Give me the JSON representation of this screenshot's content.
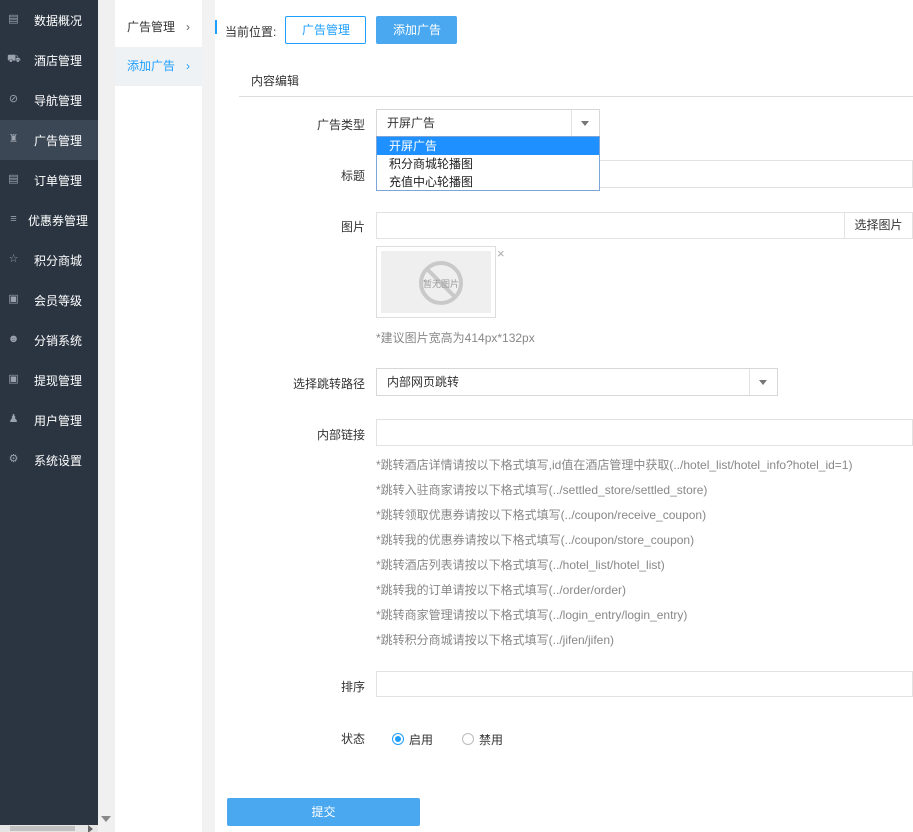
{
  "sidebar": {
    "items": [
      {
        "label": "数据概况",
        "icon": "chart-icon"
      },
      {
        "label": "酒店管理",
        "icon": "cart-icon"
      },
      {
        "label": "导航管理",
        "icon": "compass-icon"
      },
      {
        "label": "广告管理",
        "icon": "gift-icon",
        "active": true
      },
      {
        "label": "订单管理",
        "icon": "list-icon"
      },
      {
        "label": "优惠券管理",
        "icon": "menu-icon"
      },
      {
        "label": "积分商城",
        "icon": "star-icon"
      },
      {
        "label": "会员等级",
        "icon": "money-icon"
      },
      {
        "label": "分销系统",
        "icon": "users-icon"
      },
      {
        "label": "提现管理",
        "icon": "money-icon"
      },
      {
        "label": "用户管理",
        "icon": "user-icon"
      },
      {
        "label": "系统设置",
        "icon": "gear-icon"
      }
    ]
  },
  "subnav": {
    "items": [
      {
        "label": "广告管理",
        "chevron": "›"
      },
      {
        "label": "添加广告",
        "chevron": "›",
        "active": true
      }
    ]
  },
  "breadcrumb": {
    "label": "当前位置:",
    "items": [
      "广告管理",
      "添加广告"
    ]
  },
  "form": {
    "section_title": "内容编辑",
    "ad_type": {
      "label": "广告类型",
      "value": "开屏广告",
      "options": [
        "开屏广告",
        "积分商城轮播图",
        "充值中心轮播图"
      ]
    },
    "title": {
      "label": "标题",
      "value": ""
    },
    "image": {
      "label": "图片",
      "value": "",
      "pick_button": "选择图片",
      "placeholder_text": "暂无图片",
      "close_glyph": "×",
      "hint": "*建议图片宽高为414px*132px"
    },
    "jump_path": {
      "label": "选择跳转路径",
      "value": "内部网页跳转"
    },
    "inner_link": {
      "label": "内部链接",
      "value": "",
      "hints": [
        "*跳转酒店详情请按以下格式填写,id值在酒店管理中获取(../hotel_list/hotel_info?hotel_id=1)",
        "*跳转入驻商家请按以下格式填写(../settled_store/settled_store)",
        "*跳转领取优惠券请按以下格式填写(../coupon/receive_coupon)",
        "*跳转我的优惠券请按以下格式填写(../coupon/store_coupon)",
        "*跳转酒店列表请按以下格式填写(../hotel_list/hotel_list)",
        "*跳转我的订单请按以下格式填写(../order/order)",
        "*跳转商家管理请按以下格式填写(../login_entry/login_entry)",
        "*跳转积分商城请按以下格式填写(../jifen/jifen)"
      ]
    },
    "sort": {
      "label": "排序",
      "value": ""
    },
    "status": {
      "label": "状态",
      "options": [
        {
          "label": "启用",
          "checked": true
        },
        {
          "label": "禁用",
          "checked": false
        }
      ]
    },
    "submit_label": "提交"
  },
  "colors": {
    "sidebar_bg": "#2b3542",
    "accent": "#1e9fff",
    "button_fill": "#4aa8f0"
  }
}
